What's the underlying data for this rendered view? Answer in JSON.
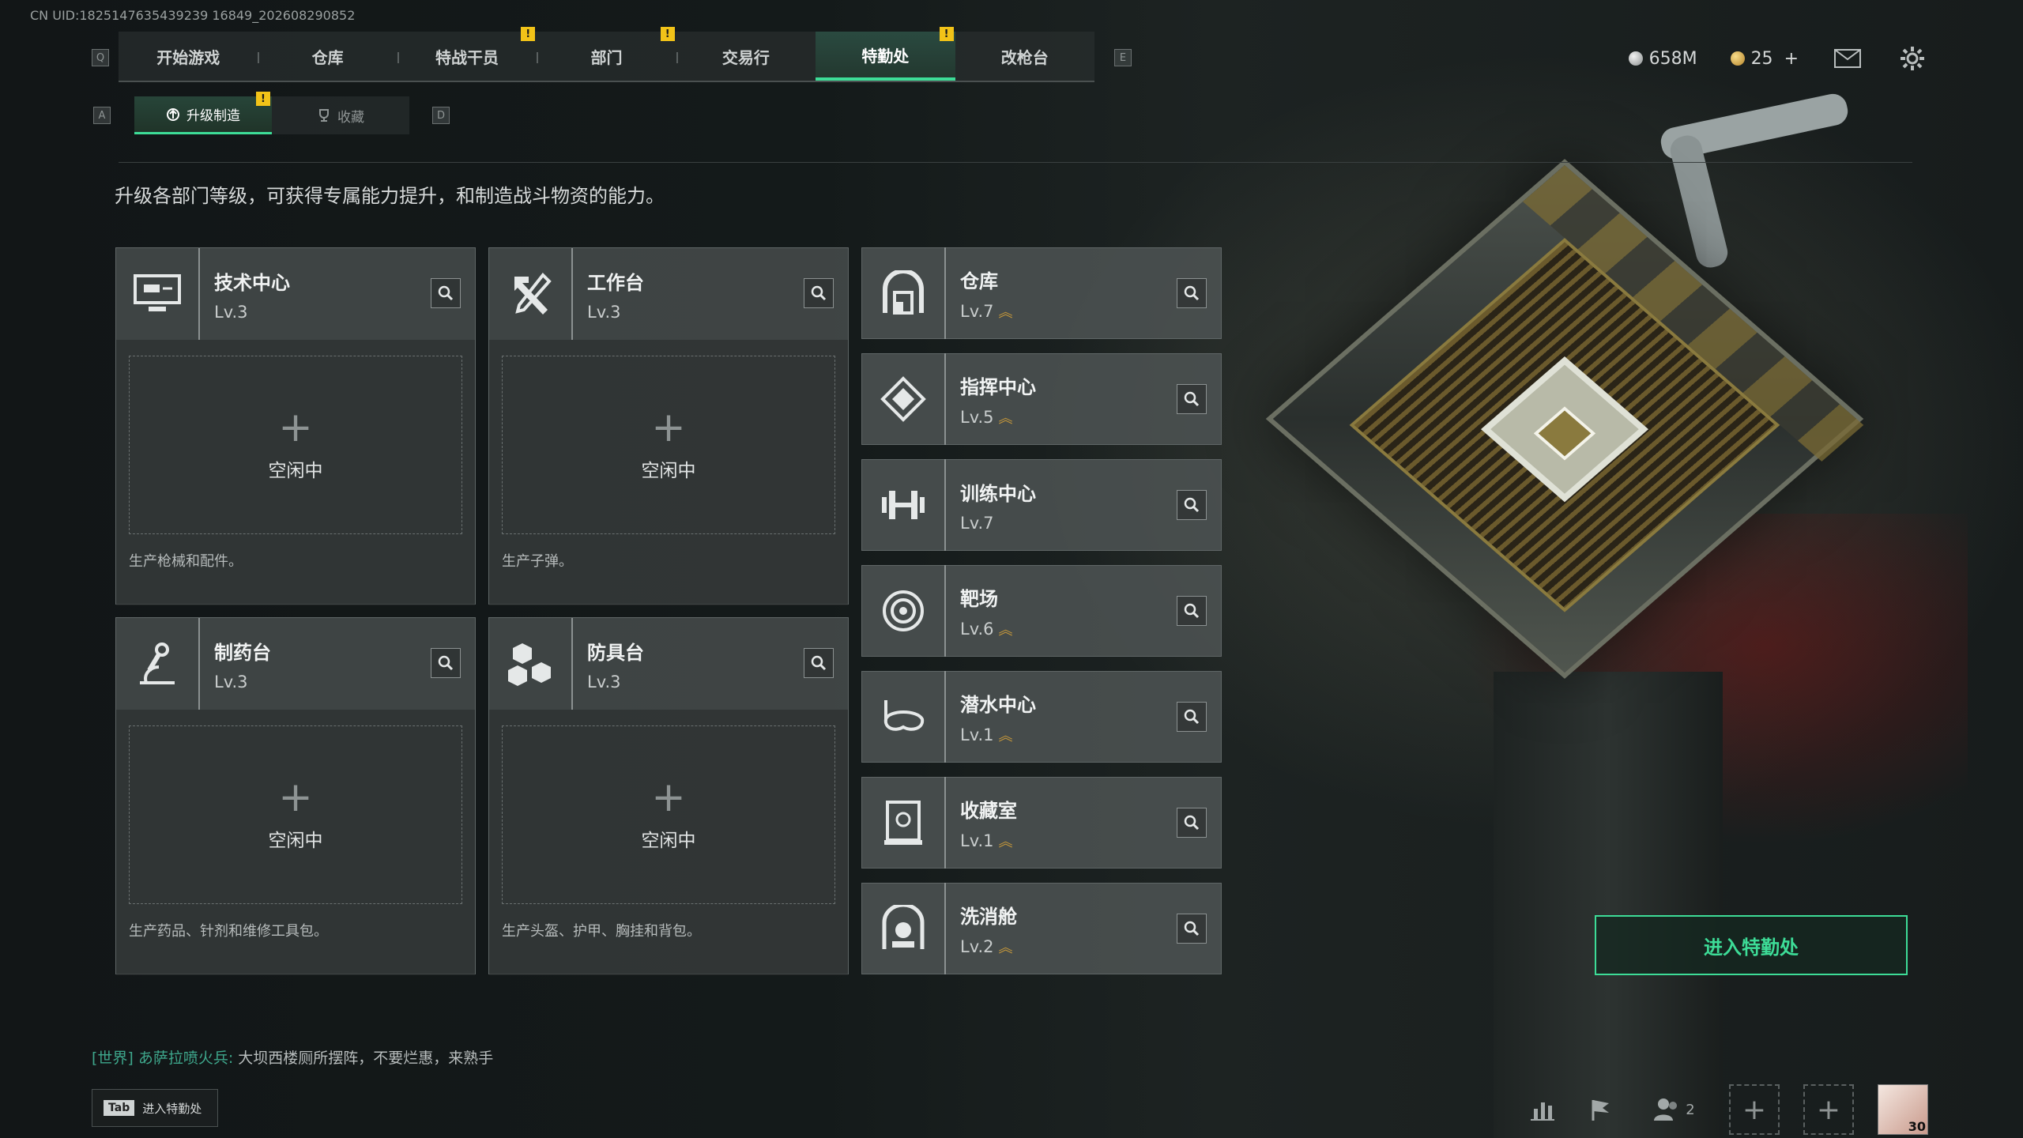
{
  "uid": "CN UID:1825147635439239 16849_202608290852",
  "nav": {
    "items": [
      {
        "label": "开始游戏",
        "badge": ""
      },
      {
        "label": "仓库",
        "badge": ""
      },
      {
        "label": "特战干员",
        "badge": "!"
      },
      {
        "label": "部门",
        "badge": "!"
      },
      {
        "label": "交易行",
        "badge": ""
      },
      {
        "label": "特勤处",
        "badge": "!",
        "active": true
      },
      {
        "label": "改枪台",
        "badge": ""
      }
    ],
    "key_left": "Q",
    "key_right": "E"
  },
  "resources": {
    "silver": "658M",
    "gold": "25",
    "gold_add": "+"
  },
  "subtabs": {
    "key_left": "A",
    "key_right": "D",
    "items": [
      {
        "label": "升级制造",
        "badge": "!",
        "active": true
      },
      {
        "label": "收藏",
        "badge": ""
      }
    ]
  },
  "description": "升级各部门等级，可获得专属能力提升，和制造战斗物资的能力。",
  "production": [
    {
      "name": "技术中心",
      "level": "Lv.3",
      "icon": "computer-icon",
      "slot_plus": "+",
      "slot_status": "空闲中",
      "slot_desc": "生产枪械和配件。"
    },
    {
      "name": "工作台",
      "level": "Lv.3",
      "icon": "tools-icon",
      "slot_plus": "+",
      "slot_status": "空闲中",
      "slot_desc": "生产子弹。"
    },
    {
      "name": "制药台",
      "level": "Lv.3",
      "icon": "microscope-icon",
      "slot_plus": "+",
      "slot_status": "空闲中",
      "slot_desc": "生产药品、针剂和维修工具包。"
    },
    {
      "name": "防具台",
      "level": "Lv.3",
      "icon": "boxes-icon",
      "slot_plus": "+",
      "slot_status": "空闲中",
      "slot_desc": "生产头盔、护甲、胸挂和背包。"
    }
  ],
  "facilities": [
    {
      "name": "仓库",
      "level": "Lv.7",
      "upgradable": true,
      "icon": "warehouse-icon"
    },
    {
      "name": "指挥中心",
      "level": "Lv.5",
      "upgradable": true,
      "icon": "command-icon"
    },
    {
      "name": "训练中心",
      "level": "Lv.7",
      "upgradable": false,
      "icon": "dumbbell-icon"
    },
    {
      "name": "靶场",
      "level": "Lv.6",
      "upgradable": true,
      "icon": "target-icon"
    },
    {
      "name": "潜水中心",
      "level": "Lv.1",
      "upgradable": true,
      "icon": "diving-mask-icon"
    },
    {
      "name": "收藏室",
      "level": "Lv.1",
      "upgradable": true,
      "icon": "collection-icon"
    },
    {
      "name": "洗消舱",
      "level": "Lv.2",
      "upgradable": true,
      "icon": "decontamination-icon"
    }
  ],
  "enter_button": "进入特勤处",
  "chat": {
    "channel": "[世界]",
    "sender": "あ萨拉喷火兵:",
    "message": "大坝西楼厕所摆阵，不要烂惠，来熟手"
  },
  "tab_hint": {
    "key": "Tab",
    "label": "进入特勤处"
  },
  "bottom_bar": {
    "friends_count": "2",
    "add_1": "+",
    "add_2": "+",
    "avatar_level": "30"
  },
  "colors": {
    "accent": "#3ddc97",
    "badge": "#f2c318",
    "upgrade": "#c99a3a"
  }
}
